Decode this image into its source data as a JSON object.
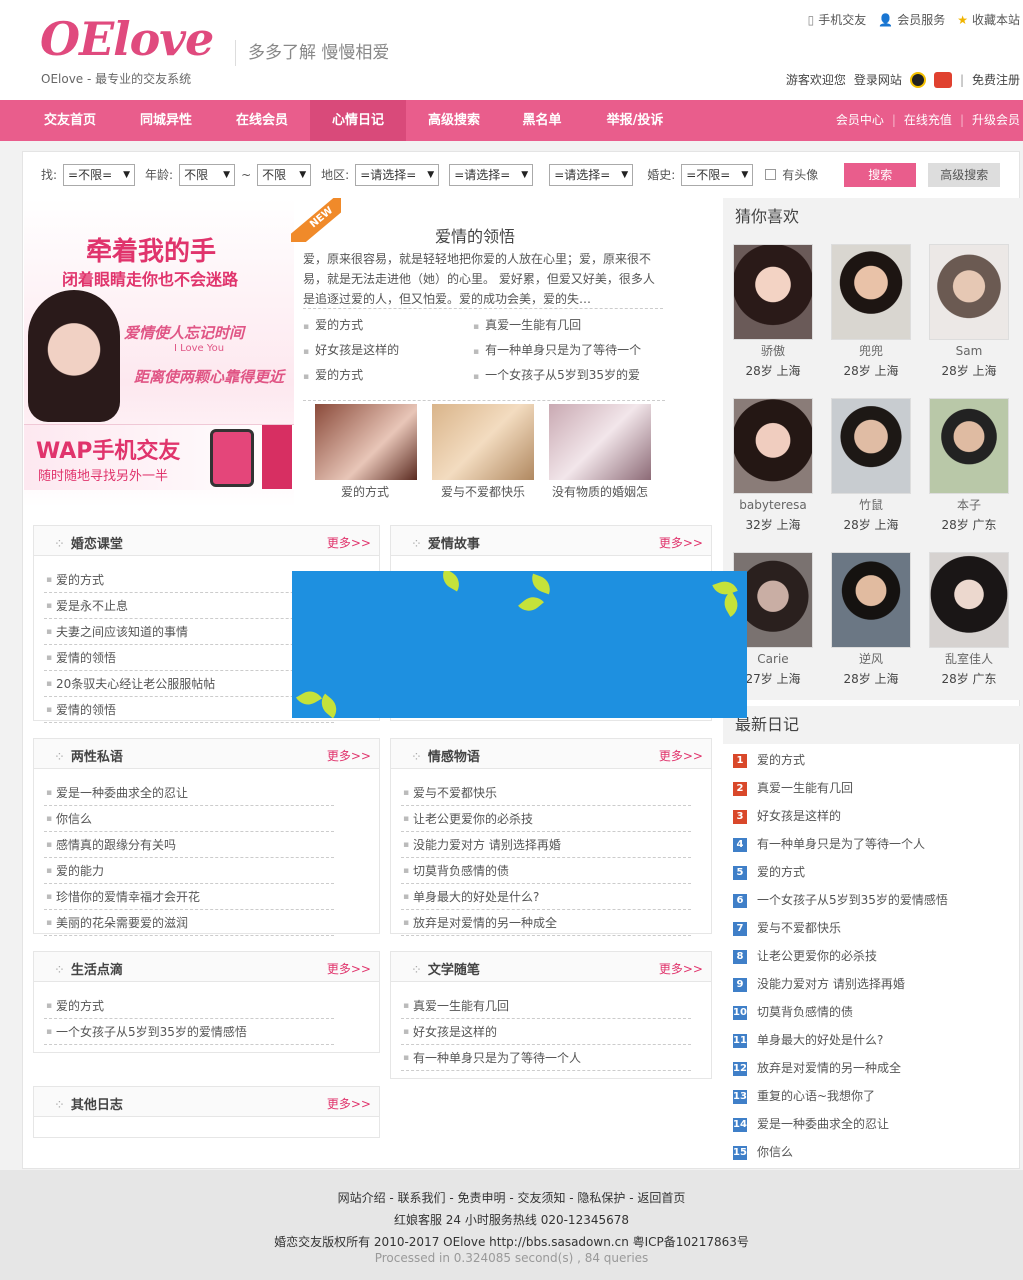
{
  "header": {
    "logo": "OElove",
    "tagline": "OElove - 最专业的交友系统",
    "slogan": "多多了解  慢慢相爱",
    "top_links": [
      "手机交友",
      "会员服务",
      "收藏本站"
    ],
    "welcome": "游客欢迎您",
    "login": "登录网站",
    "register": "免费注册"
  },
  "nav": {
    "items": [
      "交友首页",
      "同城异性",
      "在线会员",
      "心情日记",
      "高级搜索",
      "黑名单",
      "举报/投诉"
    ],
    "active_index": 3,
    "right": [
      "会员中心",
      "在线充值",
      "升级会员"
    ]
  },
  "search": {
    "l_find": "找:",
    "find": "=不限=",
    "l_age": "年龄:",
    "age_from": "不限",
    "tilde": "~",
    "age_to": "不限",
    "l_area": "地区:",
    "area1": "=请选择=",
    "area2": "=请选择=",
    "area3": "=请选择=",
    "l_marry": "婚史:",
    "marry": "=不限=",
    "has_photo": "有头像",
    "search_btn": "搜索",
    "advanced_btn": "高级搜索"
  },
  "banner": {
    "line1": "牵着我的手",
    "line2": "闭着眼睛走你也不会迷路",
    "line3": "爱情使人忘记时间",
    "line3_en": "I Love You",
    "line4": "距离使两颗心靠得更近",
    "wap1": "WAP手机交友",
    "wap2": "随时随地寻找另外一半"
  },
  "featured": {
    "new_tag": "NEW",
    "title": "爱情的领悟",
    "text": "爱，原来很容易，就是轻轻地把你爱的人放在心里；爱，原来很不易，就是无法走进他（她）的心里。    爱好累，但爱又好美，很多人是追逐过爱的人，但又怕爱。爱的成功会美，爱的失…",
    "list": [
      "爱的方式",
      "真爱一生能有几回",
      "好女孩是这样的",
      "有一种单身只是为了等待一个",
      "爱的方式",
      "一个女孩子从5岁到35岁的爱"
    ],
    "thumbs": [
      "爱的方式",
      "爱与不爱都快乐",
      "没有物质的婚姻怎"
    ]
  },
  "boxes": [
    {
      "title": "婚恋课堂",
      "more": "更多>>",
      "items": [
        "爱的方式",
        "爱是永不止息",
        "夫妻之间应该知道的事情",
        "爱情的领悟",
        "20条驭夫心经让老公服服帖帖",
        "爱情的领悟"
      ]
    },
    {
      "title": "爱情故事",
      "more": "更多>>",
      "items": []
    },
    {
      "title": "两性私语",
      "more": "更多>>",
      "items": [
        "爱是一种委曲求全的忍让",
        "你信么",
        "感情真的跟缘分有关吗",
        "爱的能力",
        "珍惜你的爱情幸福才会开花",
        "美丽的花朵需要爱的滋润"
      ]
    },
    {
      "title": "情感物语",
      "more": "更多>>",
      "items": [
        "爱与不爱都快乐",
        "让老公更爱你的必杀技",
        "没能力爱对方 请别选择再婚",
        "切莫背负感情的债",
        "单身最大的好处是什么?",
        "放弃是对爱情的另一种成全"
      ]
    },
    {
      "title": "生活点滴",
      "more": "更多>>",
      "items": [
        "爱的方式",
        "一个女孩子从5岁到35岁的爱情感悟"
      ]
    },
    {
      "title": "文学随笔",
      "more": "更多>>",
      "items": [
        "真爱一生能有几回",
        "好女孩是这样的",
        "有一种单身只是为了等待一个人"
      ]
    },
    {
      "title": "其他日志",
      "more": "更多>>",
      "items": []
    }
  ],
  "sidebar": {
    "guess_title": "猜你喜欢",
    "users": [
      {
        "name": "骄傲",
        "info": "28岁 上海"
      },
      {
        "name": "兜兜",
        "info": "28岁 上海"
      },
      {
        "name": "Sam",
        "info": "28岁 上海"
      },
      {
        "name": "babyteresa",
        "info": "32岁 上海"
      },
      {
        "name": "竹鼠",
        "info": "28岁 上海"
      },
      {
        "name": "本子",
        "info": "28岁 广东"
      },
      {
        "name": "Carie",
        "info": "27岁 上海"
      },
      {
        "name": "逆风",
        "info": "28岁 上海"
      },
      {
        "name": "乱室佳人",
        "info": "28岁 广东"
      }
    ],
    "diary_title": "最新日记",
    "diaries": [
      "爱的方式",
      "真爱一生能有几回",
      "好女孩是这样的",
      "有一种单身只是为了等待一个人",
      "爱的方式",
      "一个女孩子从5岁到35岁的爱情感悟",
      "爱与不爱都快乐",
      "让老公更爱你的必杀技",
      "没能力爱对方 请别选择再婚",
      "切莫背负感情的债",
      "单身最大的好处是什么?",
      "放弃是对爱情的另一种成全",
      "重复的心语~我想你了",
      "爱是一种委曲求全的忍让",
      "你信么"
    ],
    "diary_nums": [
      "1",
      "2",
      "3",
      "4",
      "5",
      "6",
      "7",
      "8",
      "9",
      "10",
      "11",
      "12",
      "13",
      "14",
      "15"
    ]
  },
  "footer": {
    "links": "网站介绍 - 联系我们 - 免责申明 - 交友须知 - 隐私保护 - 返回首页",
    "service": "红娘客服      24 小时服务热线 020-12345678",
    "copyright": "婚恋交友版权所有 2010-2017 OElove http://bbs.sasadown.cn    粤ICP备10217863号",
    "processed": "Processed in 0.324085 second(s) , 84 queries"
  },
  "colors": {
    "brand": "#e95d8c",
    "accent": "#e0346c",
    "rank_top": "#d9482a",
    "rank_rest": "#3f7fc8",
    "ad_bg": "#1e90e0"
  }
}
